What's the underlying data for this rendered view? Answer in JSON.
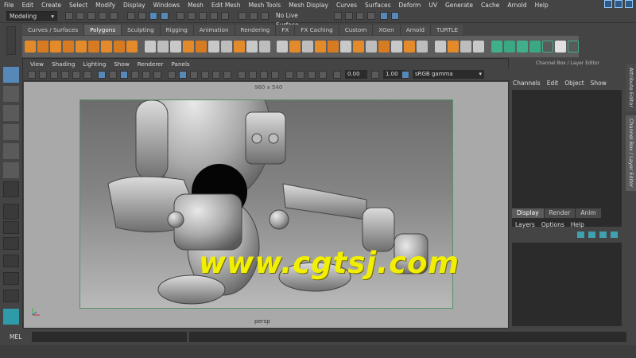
{
  "menubar": [
    "File",
    "Edit",
    "Create",
    "Select",
    "Modify",
    "Display",
    "Windows",
    "Mesh",
    "Edit Mesh",
    "Mesh Tools",
    "Mesh Display",
    "Curves",
    "Surfaces",
    "Deform",
    "UV",
    "Generate",
    "Cache",
    "Arnold",
    "Help"
  ],
  "status": {
    "mode": "Modeling",
    "live_surface": "No Live Surface"
  },
  "shelf_tabs": [
    "Curves / Surfaces",
    "Polygons",
    "Sculpting",
    "Rigging",
    "Animation",
    "Rendering",
    "FX",
    "FX Caching",
    "Custom",
    "XGen",
    "Arnold",
    "TURTLE"
  ],
  "shelf_active": "Polygons",
  "panel": {
    "menu": [
      "View",
      "Shading",
      "Lighting",
      "Show",
      "Renderer",
      "Panels"
    ],
    "exposure": "0.00",
    "gamma": "1.00",
    "color_space": "sRGB gamma",
    "resolution": "960 x 540",
    "camera": "persp"
  },
  "watermark": "www.cgtsj.com",
  "channel_box": {
    "title": "Channel Box / Layer Editor",
    "menu": [
      "Channels",
      "Edit",
      "Object",
      "Show"
    ]
  },
  "layer_editor": {
    "tabs": [
      "Display",
      "Render",
      "Anim"
    ],
    "menu": [
      "Layers",
      "Options",
      "Help"
    ]
  },
  "side_tabs": [
    "Attribute Editor",
    "Channel Box / Layer Editor"
  ],
  "command_line": {
    "label": "MEL"
  }
}
